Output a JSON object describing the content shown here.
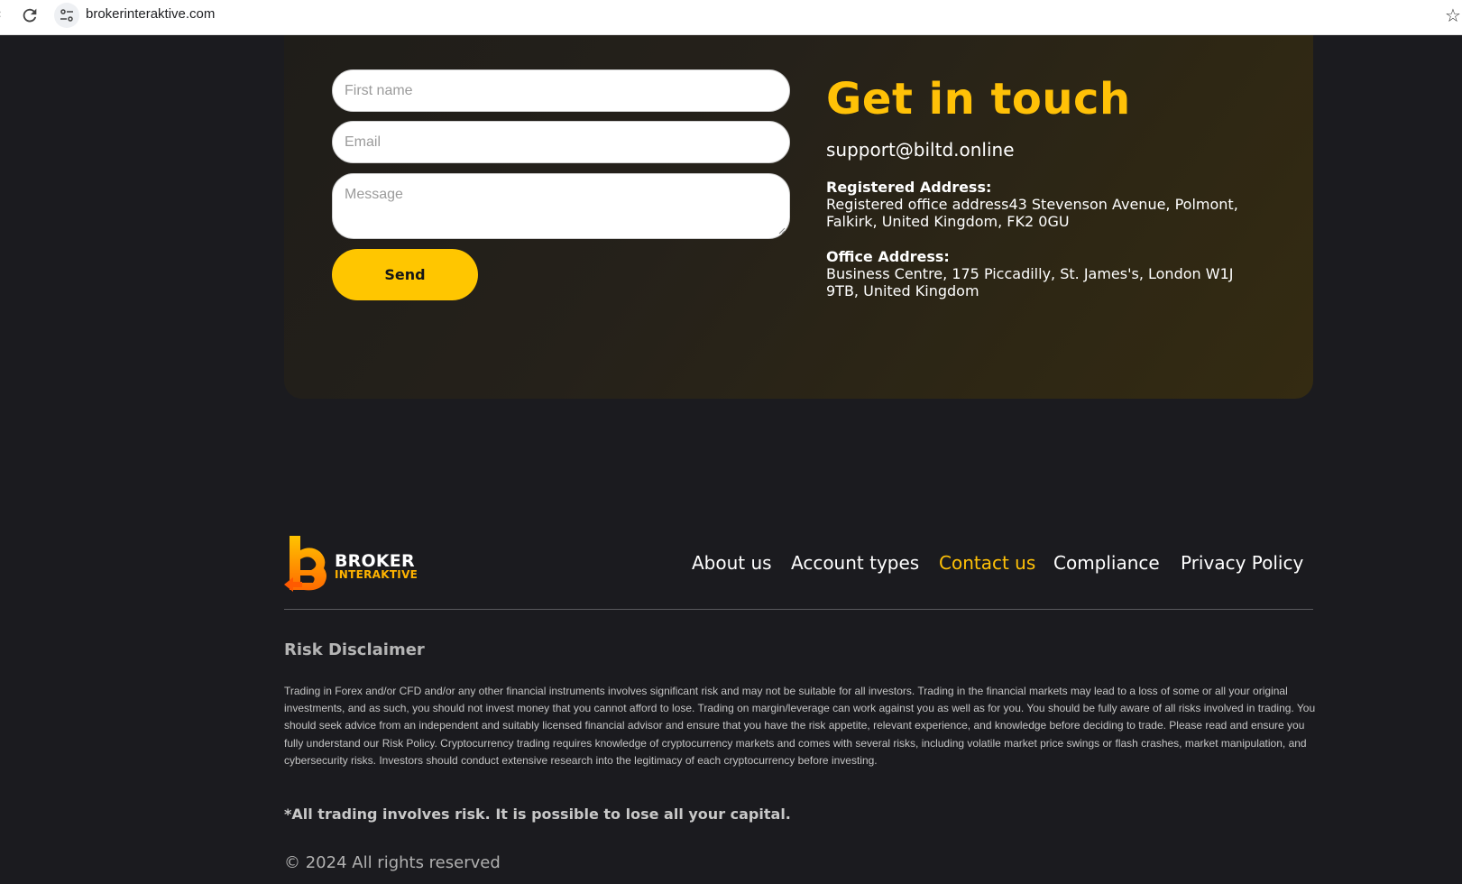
{
  "browser": {
    "url": "brokerinteraktive.com",
    "icons": [
      "back-icon",
      "reload-icon",
      "site-info-icon",
      "bookmark-star-icon"
    ]
  },
  "contact_form": {
    "first_name_placeholder": "First name",
    "email_placeholder": "Email",
    "message_placeholder": "Message",
    "send_label": "Send"
  },
  "contact_info": {
    "title": "Get in touch",
    "email": "support@biltd.online",
    "registered_label": "Registered Address:",
    "registered_address": "Registered office address43 Stevenson Avenue, Polmont, Falkirk, United Kingdom, FK2 0GU",
    "office_label": "Office Address:",
    "office_address": "Business Centre, 175 Piccadilly, St. James's, London W1J 9TB, United Kingdom"
  },
  "footer": {
    "logo": {
      "line1": "BROKER",
      "line2": "INTERAKTIVE"
    },
    "nav": [
      {
        "label": "About us"
      },
      {
        "label": "Account types"
      },
      {
        "label": "Contact us"
      },
      {
        "label": "Compliance"
      },
      {
        "label": "Privacy Policy"
      }
    ],
    "active_nav": "Contact us",
    "risk_title": "Risk Disclaimer",
    "risk_text": "Trading in Forex and/or CFD and/or any other financial instruments involves significant risk and may not be suitable for all investors. Trading in the financial markets may lead to a loss of some or all your original investments, and as such, you should not invest money that you cannot afford to lose. Trading on margin/leverage can work against you as well as for you. You should be fully aware of all risks involved in trading. You should seek advice from an independent and suitably licensed financial advisor and ensure that you have the risk appetite, relevant experience, and knowledge before deciding to trade. Please read and ensure you fully understand our Risk Policy. Cryptocurrency trading requires knowledge of cryptocurrency markets and comes with several risks, including volatile market price swings or flash crashes, market manipulation, and cybersecurity risks. Investors should conduct extensive research into the legitimacy of each cryptocurrency before investing.",
    "risk_warning": "*All trading involves risk. It is possible to lose all your capital.",
    "copyright": "© 2024 All rights reserved"
  },
  "colors": {
    "accent": "#ffc107",
    "button": "#ffc600",
    "background": "#1b1b1f"
  }
}
